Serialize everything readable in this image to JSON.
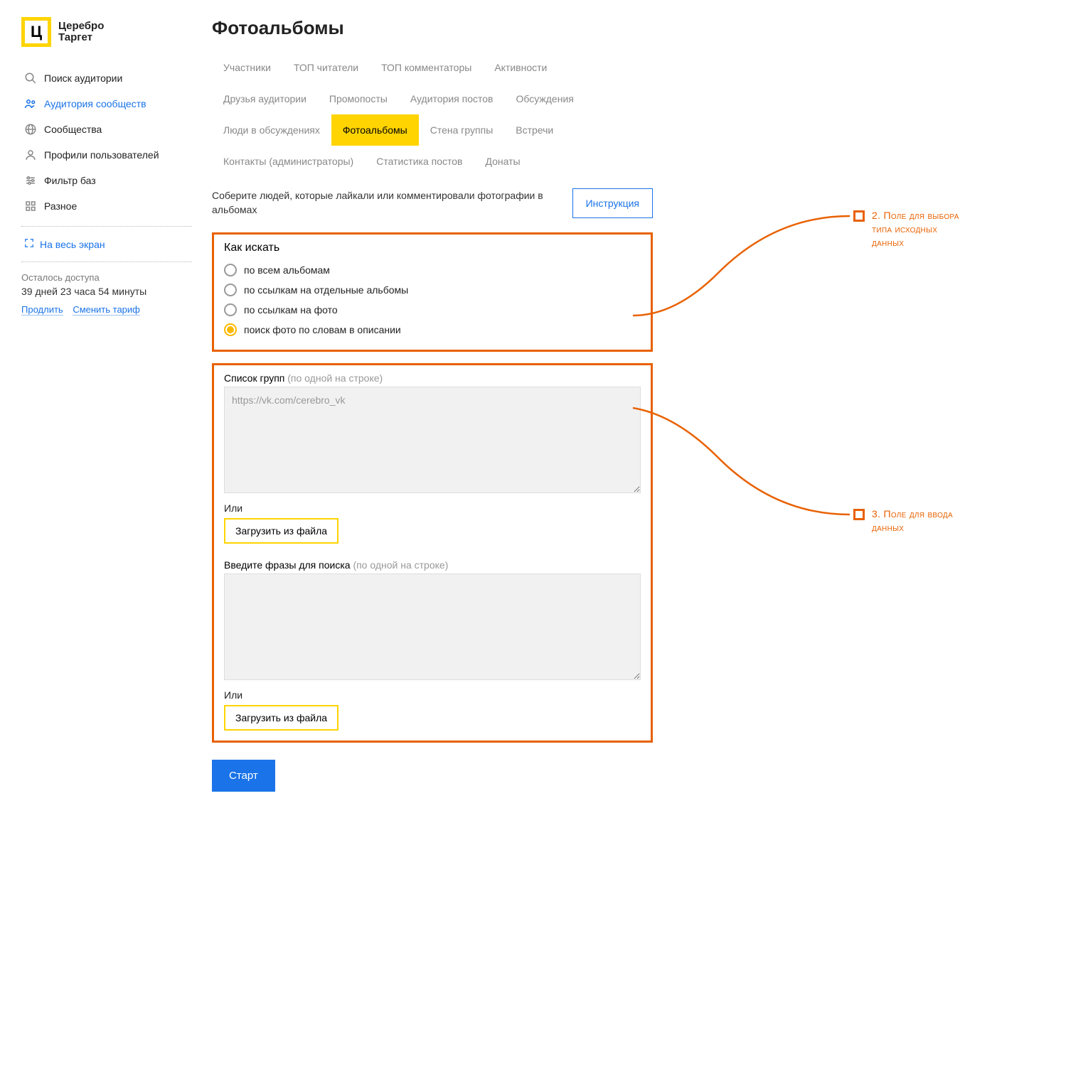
{
  "brand": {
    "letter": "Ц",
    "line1": "Церебро",
    "line2": "Таргет"
  },
  "sidebar": {
    "items": [
      {
        "label": "Поиск аудитории",
        "active": false
      },
      {
        "label": "Аудитория сообществ",
        "active": true
      },
      {
        "label": "Сообщества",
        "active": false
      },
      {
        "label": "Профили пользователей",
        "active": false
      },
      {
        "label": "Фильтр баз",
        "active": false
      },
      {
        "label": "Разное",
        "active": false
      }
    ],
    "fullscreen": "На весь экран",
    "access_label": "Осталось доступа",
    "access_remaining": "39 дней 23 часа 54 минуты",
    "extend": "Продлить",
    "change_plan": "Сменить тариф"
  },
  "main": {
    "title": "Фотоальбомы",
    "tabs": [
      "Участники",
      "ТОП читатели",
      "ТОП комментаторы",
      "Активности",
      "Друзья аудитории",
      "Промопосты",
      "Аудитория постов",
      "Обсуждения",
      "Люди в обсуждениях",
      "Фотоальбомы",
      "Стена группы",
      "Встречи",
      "Контакты (администраторы)",
      "Статистика постов",
      "Донаты"
    ],
    "active_tab_index": 9,
    "description": "Соберите людей, которые лайкали или комментировали фотографии в альбомах",
    "instruction_btn": "Инструкция",
    "search_block": {
      "title": "Как искать",
      "options": [
        "по всем альбомам",
        "по ссылкам на отдельные альбомы",
        "по ссылкам на фото",
        "поиск фото по словам в описании"
      ],
      "selected_index": 3
    },
    "input_block": {
      "groups_label": "Список групп",
      "groups_hint": "(по одной на строке)",
      "groups_placeholder": "https://vk.com/cerebro_vk",
      "or": "Или",
      "file_btn": "Загрузить из файла",
      "phrases_label": "Введите фразы для поиска",
      "phrases_hint": "(по одной на строке)"
    },
    "start_btn": "Старт"
  },
  "annotations": {
    "a2": "2. Поле для выбора типа исходных данных",
    "a3": "3. Поле для ввода данных"
  }
}
